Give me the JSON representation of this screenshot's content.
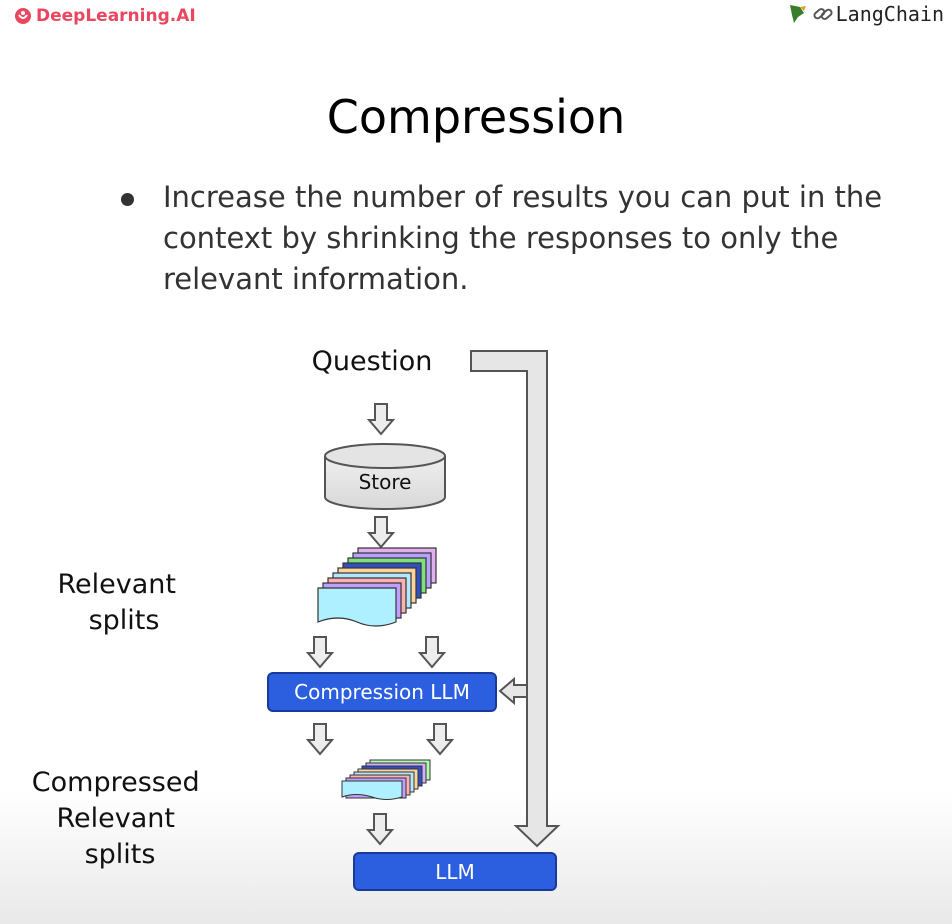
{
  "header": {
    "left_brand": "DeepLearning.AI",
    "right_brand": "LangChain"
  },
  "slide": {
    "title": "Compression",
    "bullet": "Increase the number of results you can put in the context by shrinking the responses to only the relevant information."
  },
  "diagram": {
    "question_label": "Question",
    "store_label": "Store",
    "relevant_splits_label": [
      "Relevant",
      "splits"
    ],
    "compression_llm_label": "Compression LLM",
    "compressed_label": [
      "Compressed",
      "Relevant",
      "splits"
    ],
    "llm_label": "LLM"
  },
  "colors": {
    "brand_red": "#e8475f",
    "llm_blue": "#2855d8",
    "arrow_gray": "#e6e6e6"
  }
}
